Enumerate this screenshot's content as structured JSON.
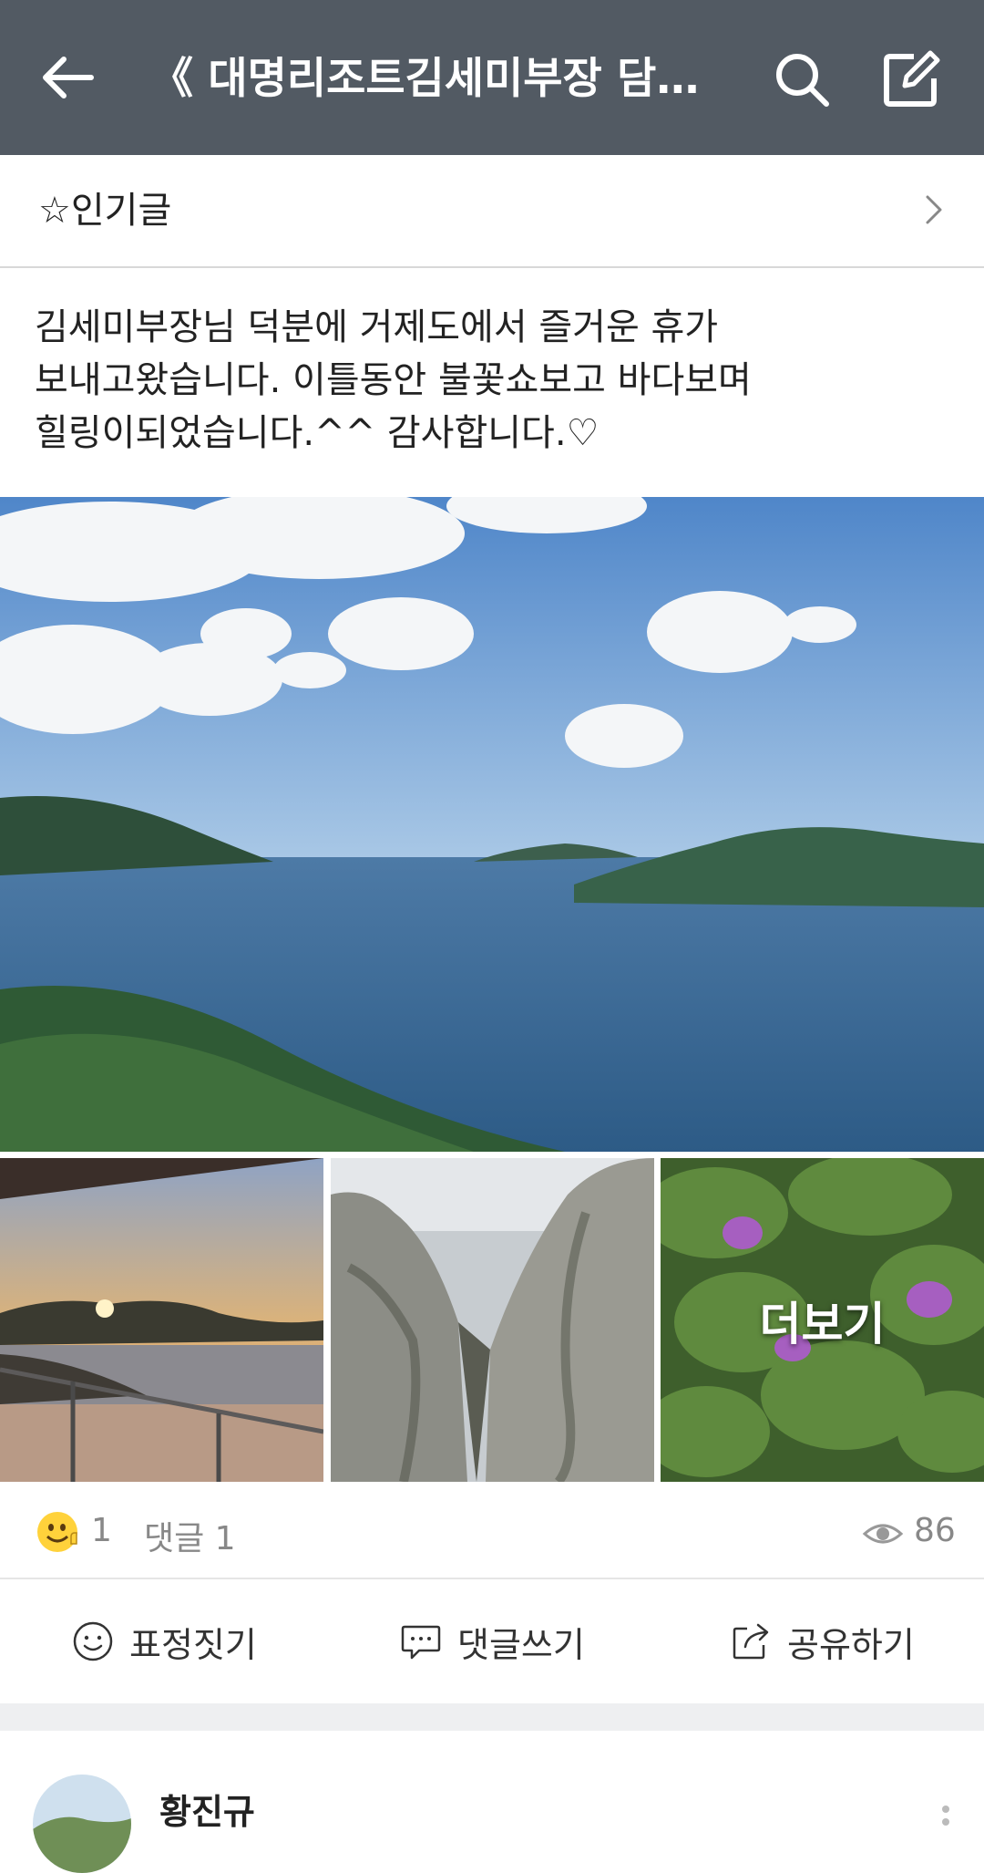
{
  "header": {
    "title": "《 대명리조트김세미부장 담…",
    "back_icon": "arrow-left-icon",
    "search_icon": "search-icon",
    "edit_icon": "compose-icon",
    "background": "#525a63"
  },
  "popular_bar": {
    "label": "☆인기글",
    "icon": "chevron-right-icon"
  },
  "post": {
    "text": "김세미부장님 덕분에 거제도에서 즐거운 휴가\n보내고왔습니다. 이틀동안 불꽃쇼보고 바다보며\n힐링이되었습니다.^^  감사합니다.♡",
    "more_label": "더보기"
  },
  "stats": {
    "like_count": "1",
    "comment_label": "댓글 1",
    "views": "86"
  },
  "actions": {
    "react": "표정짓기",
    "comment": "댓글쓰기",
    "share": "공유하기"
  },
  "comment": {
    "author": "황진규"
  }
}
